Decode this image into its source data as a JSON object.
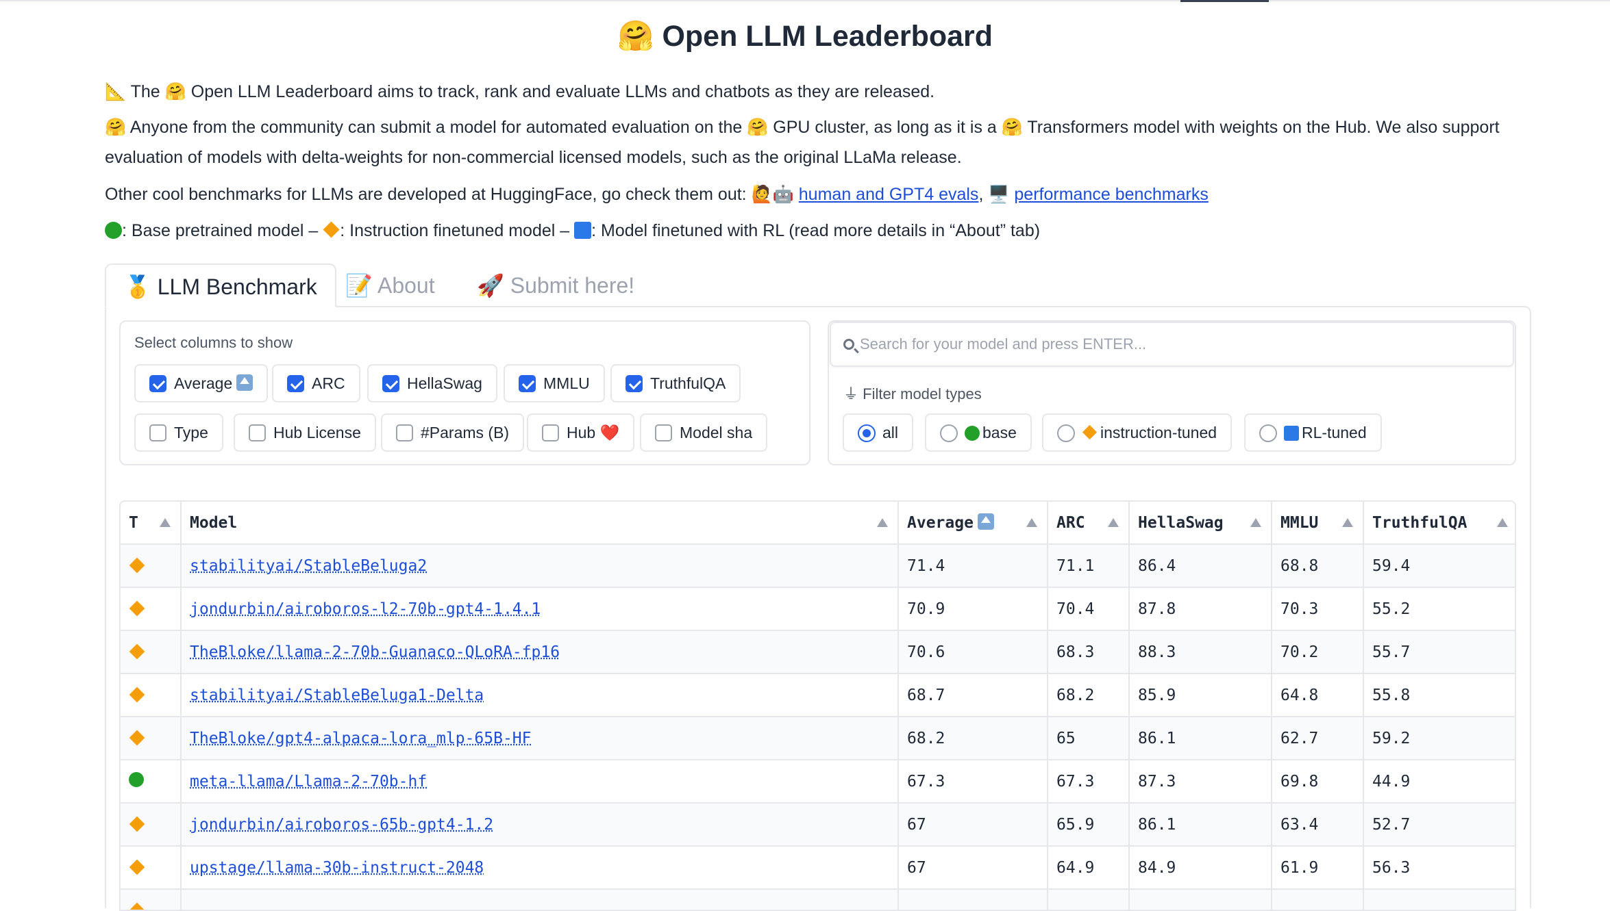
{
  "header": {
    "title": "Open LLM Leaderboard",
    "title_emoji": "🤗"
  },
  "intro": {
    "line1_prefix": "📐 The ",
    "line1_emoji": "🤗",
    "line1_text": " Open LLM Leaderboard aims to track, rank and evaluate LLMs and chatbots as they are released.",
    "line2_parts": [
      "🤗",
      " Anyone from the community can submit a model for automated evaluation on the ",
      "🤗",
      " GPU cluster, as long as it is a ",
      "🤗",
      " Transformers model with weights on the Hub. We also support evaluation of models with delta-weights for non-commercial licensed models, such as the original LLaMa release."
    ],
    "line3_text": "Other cool benchmarks for LLMs are developed at HuggingFace, go check them out: 🙋🤖 ",
    "line3_link1": "human and GPT4 evals",
    "line3_sep": ", 🖥️ ",
    "line3_link2": "performance benchmarks",
    "legend_base": ": Base pretrained model – ",
    "legend_instr": ": Instruction finetuned model – ",
    "legend_rl": ": Model finetuned with RL (read more details in “About” tab)"
  },
  "tabs": [
    {
      "label": "🥇 LLM Benchmark"
    },
    {
      "label": "📝 About"
    },
    {
      "label": "🚀 Submit here!"
    }
  ],
  "columns_selector": {
    "label": "Select columns to show",
    "options": [
      {
        "label": "Average",
        "checked": true
      },
      {
        "label": "ARC",
        "checked": true
      },
      {
        "label": "HellaSwag",
        "checked": true
      },
      {
        "label": "MMLU",
        "checked": true
      },
      {
        "label": "TruthfulQA",
        "checked": true
      },
      {
        "label": "Type",
        "checked": false
      },
      {
        "label": "Hub License",
        "checked": false
      },
      {
        "label": "#Params (B)",
        "checked": false
      },
      {
        "label": "Hub ❤️",
        "checked": false
      },
      {
        "label": "Model sha",
        "checked": false
      }
    ]
  },
  "search": {
    "placeholder": "Search for your model and press ENTER..."
  },
  "model_filter": {
    "label": "Filter model types",
    "options": [
      {
        "label": "all",
        "selected": true
      },
      {
        "label": "base",
        "selected": false
      },
      {
        "label": "instruction-tuned",
        "selected": false
      },
      {
        "label": "RL-tuned",
        "selected": false
      }
    ]
  },
  "table": {
    "headers": [
      "T",
      "Model",
      "Average",
      "ARC",
      "HellaSwag",
      "MMLU",
      "TruthfulQA"
    ],
    "rows": [
      {
        "type": "instruction-tuned",
        "model": "stabilityai/StableBeluga2",
        "average": "71.4",
        "arc": "71.1",
        "hellaswag": "86.4",
        "mmlu": "68.8",
        "truthfulqa": "59.4"
      },
      {
        "type": "instruction-tuned",
        "model": "jondurbin/airoboros-l2-70b-gpt4-1.4.1",
        "average": "70.9",
        "arc": "70.4",
        "hellaswag": "87.8",
        "mmlu": "70.3",
        "truthfulqa": "55.2"
      },
      {
        "type": "instruction-tuned",
        "model": "TheBloke/llama-2-70b-Guanaco-QLoRA-fp16",
        "average": "70.6",
        "arc": "68.3",
        "hellaswag": "88.3",
        "mmlu": "70.2",
        "truthfulqa": "55.7"
      },
      {
        "type": "instruction-tuned",
        "model": "stabilityai/StableBeluga1-Delta",
        "average": "68.7",
        "arc": "68.2",
        "hellaswag": "85.9",
        "mmlu": "64.8",
        "truthfulqa": "55.8"
      },
      {
        "type": "instruction-tuned",
        "model": "TheBloke/gpt4-alpaca-lora_mlp-65B-HF",
        "average": "68.2",
        "arc": "65",
        "hellaswag": "86.1",
        "mmlu": "62.7",
        "truthfulqa": "59.2"
      },
      {
        "type": "base",
        "model": "meta-llama/Llama-2-70b-hf",
        "average": "67.3",
        "arc": "67.3",
        "hellaswag": "87.3",
        "mmlu": "69.8",
        "truthfulqa": "44.9"
      },
      {
        "type": "instruction-tuned",
        "model": "jondurbin/airoboros-65b-gpt4-1.2",
        "average": "67",
        "arc": "65.9",
        "hellaswag": "86.1",
        "mmlu": "63.4",
        "truthfulqa": "52.7"
      },
      {
        "type": "instruction-tuned",
        "model": "upstage/llama-30b-instruct-2048",
        "average": "67",
        "arc": "64.9",
        "hellaswag": "84.9",
        "mmlu": "61.9",
        "truthfulqa": "56.3"
      },
      {
        "type": "instruction-tuned",
        "model": "",
        "average": "",
        "arc": "",
        "hellaswag": "",
        "mmlu": "",
        "truthfulqa": ""
      }
    ]
  },
  "colors": {
    "accent": "#2563eb",
    "link": "#1d4ed8",
    "base_green": "#22a02a",
    "instruct_orange": "#f59e0b",
    "rl_blue": "#2b79e6"
  }
}
